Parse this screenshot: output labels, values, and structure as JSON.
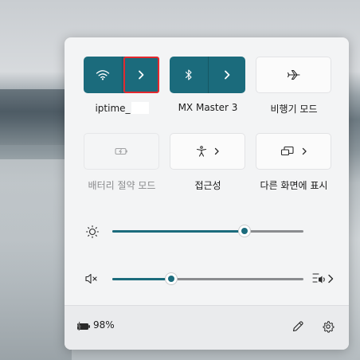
{
  "quick_settings": {
    "tiles": [
      {
        "label": "iptime_",
        "state": "on",
        "icon": "wifi-icon",
        "has_expand": true
      },
      {
        "label": "MX Master 3",
        "state": "on",
        "icon": "bluetooth-icon",
        "has_expand": true
      },
      {
        "label": "비행기 모드",
        "state": "off",
        "icon": "airplane-icon"
      },
      {
        "label": "배터리 절약 모드",
        "state": "disabled",
        "icon": "battery-saver-icon"
      },
      {
        "label": "접근성",
        "state": "off",
        "icon": "accessibility-icon",
        "has_expand": true
      },
      {
        "label": "다른 화면에 표시",
        "state": "off",
        "icon": "cast-icon",
        "has_expand": true
      }
    ],
    "brightness": {
      "icon": "brightness-icon",
      "value_percent": 69
    },
    "volume": {
      "icon": "volume-muted-icon",
      "value_percent": 31,
      "output_icon": "audio-output-icon"
    },
    "footer": {
      "battery_icon": "battery-charging-icon",
      "battery_percent": "98%",
      "edit_icon": "pencil-icon",
      "settings_icon": "gear-icon"
    },
    "accent_color": "#1b6b7c",
    "highlight_color": "#e2282e"
  }
}
